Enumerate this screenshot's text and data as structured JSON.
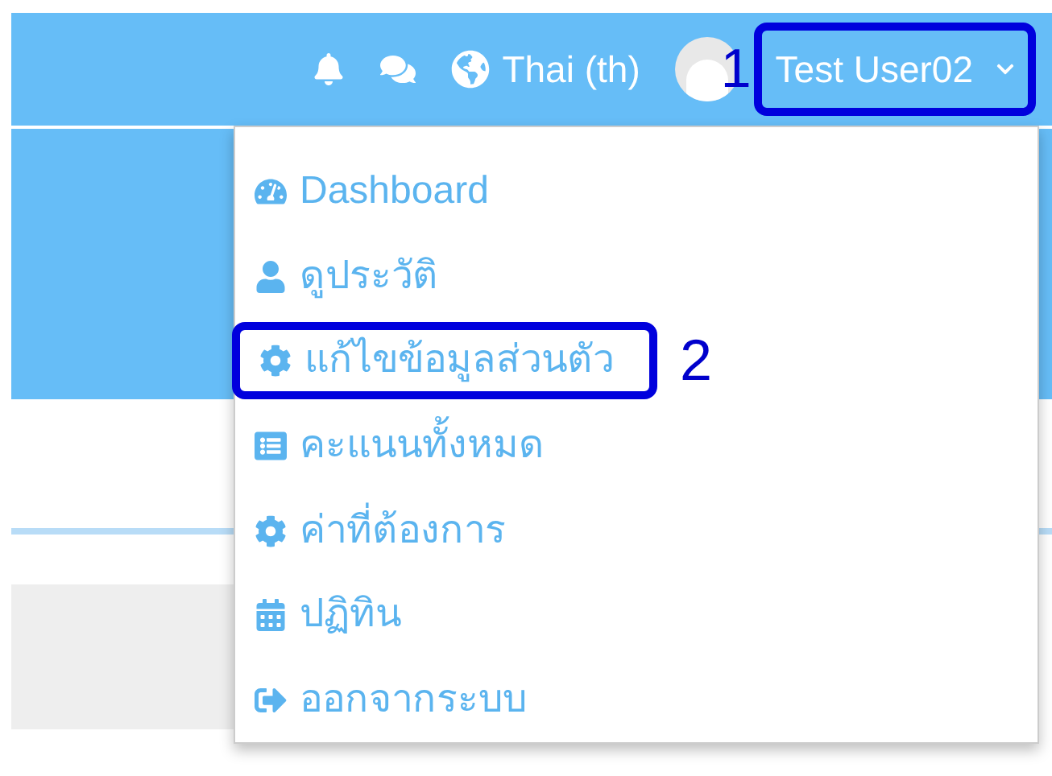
{
  "navbar": {
    "language": "Thai (th)",
    "user_name": "Test User02",
    "annotation": "1"
  },
  "user_menu": {
    "items": [
      {
        "label": "Dashboard"
      },
      {
        "label": "ดูประวัติ"
      },
      {
        "label": "แก้ไขข้อมูลส่วนตัว",
        "annotation": "2"
      },
      {
        "label": "คะแนนทั้งหมด"
      },
      {
        "label": "ค่าที่ต้องการ"
      },
      {
        "label": "ปฏิทิน"
      },
      {
        "label": "ออกจากระบบ"
      }
    ]
  }
}
